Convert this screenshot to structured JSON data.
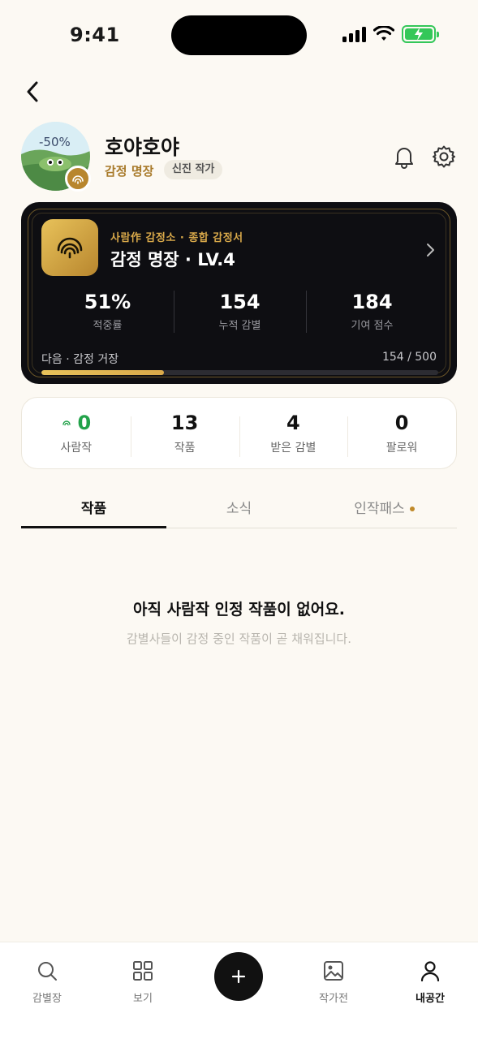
{
  "status_bar": {
    "time": "9:41"
  },
  "profile": {
    "nickname": "호야호야",
    "tier": "감정 명장",
    "badge": "신진 작가",
    "avatar_overlay_text": "-50%"
  },
  "level_card": {
    "subtitle": "사람作 감정소 · 종합 감정서",
    "title": "감정 명장 · LV.4",
    "stats": [
      {
        "value": "51%",
        "label": "적중률"
      },
      {
        "value": "154",
        "label": "누적 감별"
      },
      {
        "value": "184",
        "label": "기여 점수"
      }
    ],
    "next_label": "다음 · 감정 거장",
    "progress_text": "154 / 500",
    "progress_fraction": 0.308,
    "accent": "#d9a94a"
  },
  "stats": [
    {
      "value": "0",
      "label": "사람작",
      "color": "#22a24a"
    },
    {
      "value": "13",
      "label": "작품"
    },
    {
      "value": "4",
      "label": "받은 감별"
    },
    {
      "value": "0",
      "label": "팔로워"
    }
  ],
  "tabs": [
    {
      "label": "작품",
      "active": true
    },
    {
      "label": "소식",
      "active": false
    },
    {
      "label": "인작패스",
      "active": false,
      "dot": true
    }
  ],
  "empty_state": {
    "title": "아직 사람작 인정 작품이 없어요.",
    "description": "감별사들이 감정 중인 작품이 곧 채워집니다."
  },
  "bottom_nav": [
    {
      "label": "감별장",
      "icon": "search-icon"
    },
    {
      "label": "보기",
      "icon": "grid-icon"
    },
    {
      "label": "",
      "icon": "plus-icon"
    },
    {
      "label": "작가전",
      "icon": "image-icon"
    },
    {
      "label": "내공간",
      "icon": "user-icon",
      "active": true
    }
  ]
}
